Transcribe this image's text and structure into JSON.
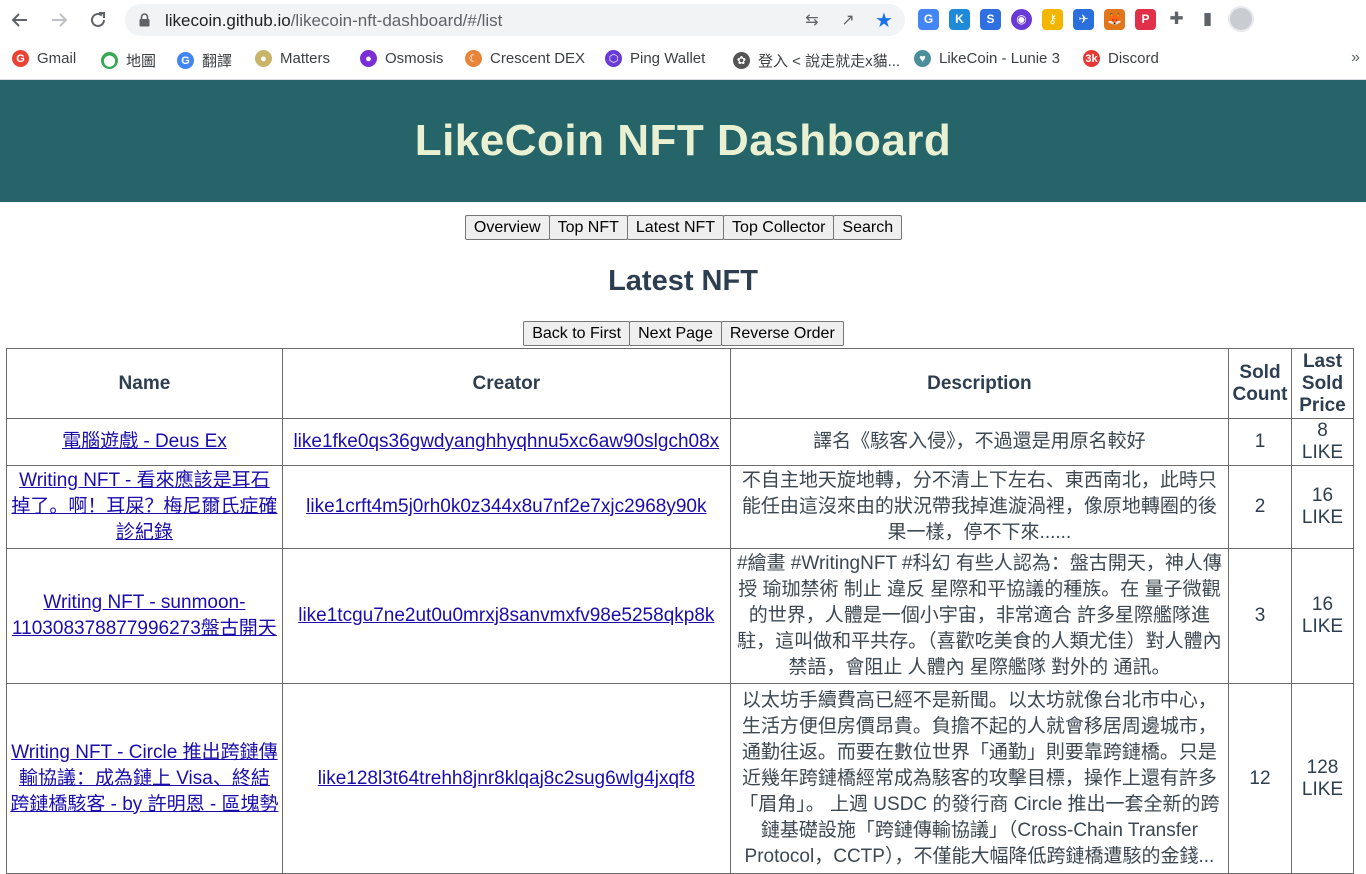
{
  "browser": {
    "url_domain": "likecoin.github.io",
    "url_path": "/likecoin-nft-dashboard/#/list",
    "bookmarks": [
      {
        "label": "Gmail",
        "icon": "gmail-icon",
        "color": "#ea4335",
        "glyph": "G"
      },
      {
        "label": "地圖",
        "icon": "maps-icon",
        "color": "#34a853",
        "glyph": "⬤"
      },
      {
        "label": "翻譯",
        "icon": "translate-icon",
        "color": "#4285f4",
        "glyph": "G"
      },
      {
        "label": "Matters",
        "icon": "matters-icon",
        "color": "#c9b56a",
        "glyph": "●"
      },
      {
        "label": "Osmosis",
        "icon": "osmosis-icon",
        "color": "#7b2fd6",
        "glyph": "●"
      },
      {
        "label": "Crescent DEX",
        "icon": "crescent-icon",
        "color": "#e8833a",
        "glyph": "☾"
      },
      {
        "label": "Ping Wallet",
        "icon": "ping-wallet-icon",
        "color": "#6a3ad6",
        "glyph": "⬡"
      },
      {
        "label": "登入 < 說走就走x貓...",
        "icon": "login-icon",
        "color": "#555555",
        "glyph": "✿"
      },
      {
        "label": "LikeCoin - Lunie 3",
        "icon": "likecoin-icon",
        "color": "#4a8f9a",
        "glyph": "♥"
      },
      {
        "label": "Discord",
        "icon": "discord-icon",
        "color": "#e53935",
        "glyph": "3k"
      }
    ]
  },
  "page": {
    "header_title": "LikeCoin NFT Dashboard",
    "nav": [
      "Overview",
      "Top NFT",
      "Latest NFT",
      "Top Collector",
      "Search"
    ],
    "section_title": "Latest NFT",
    "pager": [
      "Back to First",
      "Next Page",
      "Reverse Order"
    ]
  },
  "table": {
    "headers": {
      "name": "Name",
      "creator": "Creator",
      "description": "Description",
      "sold_count": "Sold Count",
      "last_sold_price": "Last Sold Price"
    },
    "rows": [
      {
        "name": "電腦遊戲 - Deus Ex",
        "creator": "like1fke0qs36gwdyanghhyqhnu5xc6aw90slgch08x",
        "description": "譯名《駭客入侵》，不過還是用原名較好",
        "sold_count": "1",
        "price": "8 LIKE"
      },
      {
        "name": "Writing NFT - 看來應該是耳石掉了。啊！耳屎？梅尼爾氏症確診紀錄",
        "creator": "like1crft4m5j0rh0k0z344x8u7nf2e7xjc2968y90k",
        "description": "不自主地天旋地轉，分不清上下左右、東西南北，此時只能任由這沒來由的狀況帶我掉進漩渦裡，像原地轉圈的後果一樣，停不下來......",
        "sold_count": "2",
        "price": "16 LIKE"
      },
      {
        "name": "Writing NFT - sunmoon-110308378877996273盤古開天",
        "creator": "like1tcgu7ne2ut0u0mrxj8sanvmxfv98e5258qkp8k",
        "description": "#繪畫 #WritingNFT #科幻 有些人認為：盤古開天，神人傳授 瑜珈禁術 制止 違反 星際和平協議的種族。在 量子微觀的世界，人體是一個小宇宙，非常適合 許多星際艦隊進駐，這叫做和平共存。（喜歡吃美食的人類尤佳）對人體內 禁語，會阻止 人體內 星際艦隊 對外的 通訊。",
        "sold_count": "3",
        "price": "16 LIKE"
      },
      {
        "name": "Writing NFT - Circle 推出跨鏈傳輸協議：成為鏈上 Visa、終結跨鏈橋駭客 - by 許明恩 - 區塊勢",
        "creator": "like128l3t64trehh8jnr8klqaj8c2sug6wlg4jxqf8",
        "description": "以太坊手續費高已經不是新聞。以太坊就像台北市中心，生活方便但房價昂貴。負擔不起的人就會移居周邊城市，通勤往返。而要在數位世界「通勤」則要靠跨鏈橋。只是近幾年跨鏈橋經常成為駭客的攻擊目標，操作上還有許多「眉角」。 上週 USDC 的發行商 Circle 推出一套全新的跨鏈基礎設施「跨鏈傳輸協議」（Cross-Chain Transfer Protocol，CCTP），不僅能大幅降低跨鏈橋遭駭的金錢...",
        "sold_count": "12",
        "price": "128 LIKE"
      }
    ]
  }
}
